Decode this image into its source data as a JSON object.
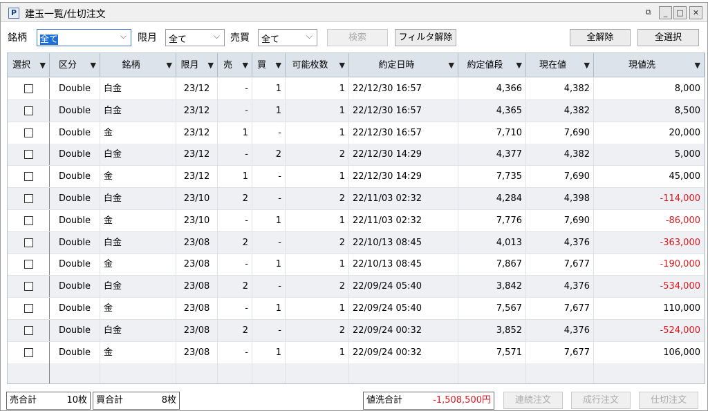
{
  "window": {
    "title": "建玉一覧/仕切注文",
    "icon_letter": "P"
  },
  "filters": {
    "meigara_label": "銘柄",
    "meigara_value": "全て",
    "gengetsu_label": "限月",
    "gengetsu_value": "全て",
    "baibai_label": "売買",
    "baibai_value": "全て"
  },
  "toolbar": {
    "search": "検索",
    "clear_filter": "フィルタ解除",
    "deselect_all": "全解除",
    "select_all": "全選択"
  },
  "columns": [
    "選択",
    "区分",
    "銘柄",
    "限月",
    "売",
    "買",
    "可能枚数",
    "約定日時",
    "約定値段",
    "現在値",
    "現値洗"
  ],
  "rows": [
    [
      "Double",
      "白金",
      "23/12",
      "-",
      "1",
      "1",
      "22/12/30 16:57",
      "4,366",
      "4,382",
      "8,000"
    ],
    [
      "Double",
      "白金",
      "23/12",
      "-",
      "1",
      "1",
      "22/12/30 16:57",
      "4,365",
      "4,382",
      "8,500"
    ],
    [
      "Double",
      "金",
      "23/12",
      "1",
      "-",
      "1",
      "22/12/30 16:57",
      "7,710",
      "7,690",
      "20,000"
    ],
    [
      "Double",
      "白金",
      "23/12",
      "-",
      "2",
      "2",
      "22/12/30 14:29",
      "4,377",
      "4,382",
      "5,000"
    ],
    [
      "Double",
      "金",
      "23/12",
      "1",
      "-",
      "1",
      "22/12/30 14:29",
      "7,735",
      "7,690",
      "45,000"
    ],
    [
      "Double",
      "白金",
      "23/10",
      "2",
      "-",
      "2",
      "22/11/03 02:32",
      "4,284",
      "4,398",
      "-114,000"
    ],
    [
      "Double",
      "金",
      "23/10",
      "-",
      "1",
      "1",
      "22/11/03 02:32",
      "7,776",
      "7,690",
      "-86,000"
    ],
    [
      "Double",
      "白金",
      "23/08",
      "2",
      "-",
      "2",
      "22/10/13 08:45",
      "4,013",
      "4,376",
      "-363,000"
    ],
    [
      "Double",
      "金",
      "23/08",
      "-",
      "1",
      "1",
      "22/10/13 08:45",
      "7,867",
      "7,677",
      "-190,000"
    ],
    [
      "Double",
      "白金",
      "23/08",
      "2",
      "-",
      "2",
      "22/09/24 05:40",
      "3,842",
      "4,376",
      "-534,000"
    ],
    [
      "Double",
      "金",
      "23/08",
      "-",
      "1",
      "1",
      "22/09/24 05:40",
      "7,567",
      "7,677",
      "110,000"
    ],
    [
      "Double",
      "白金",
      "23/08",
      "2",
      "-",
      "2",
      "22/09/24 00:32",
      "3,852",
      "4,376",
      "-524,000"
    ],
    [
      "Double",
      "金",
      "23/08",
      "-",
      "1",
      "1",
      "22/09/24 00:32",
      "7,571",
      "7,677",
      "106,000"
    ]
  ],
  "footer": {
    "sell_total_label": "売合計",
    "sell_total": "10枚",
    "buy_total_label": "買合計",
    "buy_total": "8枚",
    "pl_total_label": "値洗合計",
    "pl_total": "-1,508,500円",
    "renzoku": "連続注文",
    "nariyuki": "成行注文",
    "shikiri": "仕切注文"
  },
  "colors": {
    "negative": "#e0161b",
    "header_bg": "#dde3ea"
  }
}
